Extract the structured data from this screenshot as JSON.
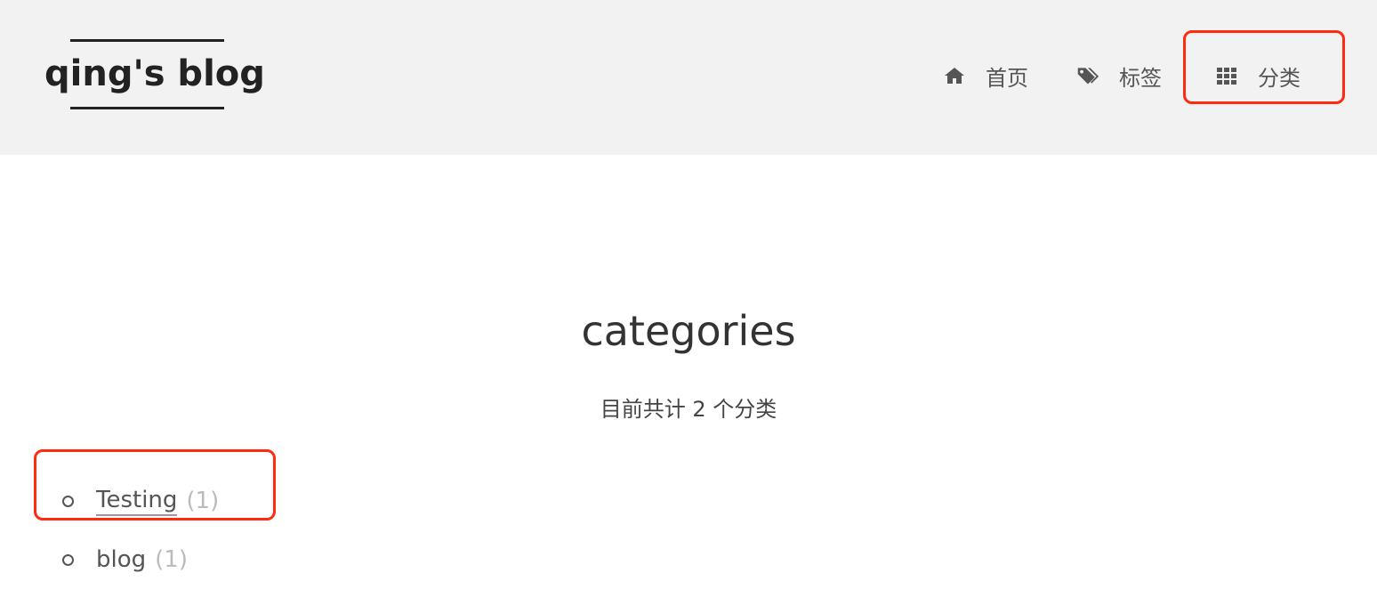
{
  "header": {
    "site_title": "qing's blog",
    "nav": [
      {
        "label": "首页",
        "icon": "home-icon"
      },
      {
        "label": "标签",
        "icon": "tags-icon"
      },
      {
        "label": "分类",
        "icon": "grid-icon"
      }
    ]
  },
  "main": {
    "title": "categories",
    "subtitle": "目前共计 2 个分类",
    "categories": [
      {
        "name": "Testing",
        "count": "(1)"
      },
      {
        "name": "blog",
        "count": "(1)"
      }
    ]
  },
  "colors": {
    "header_bg": "#f2f2f2",
    "highlight": "#ff2a0f",
    "text": "#555555"
  }
}
